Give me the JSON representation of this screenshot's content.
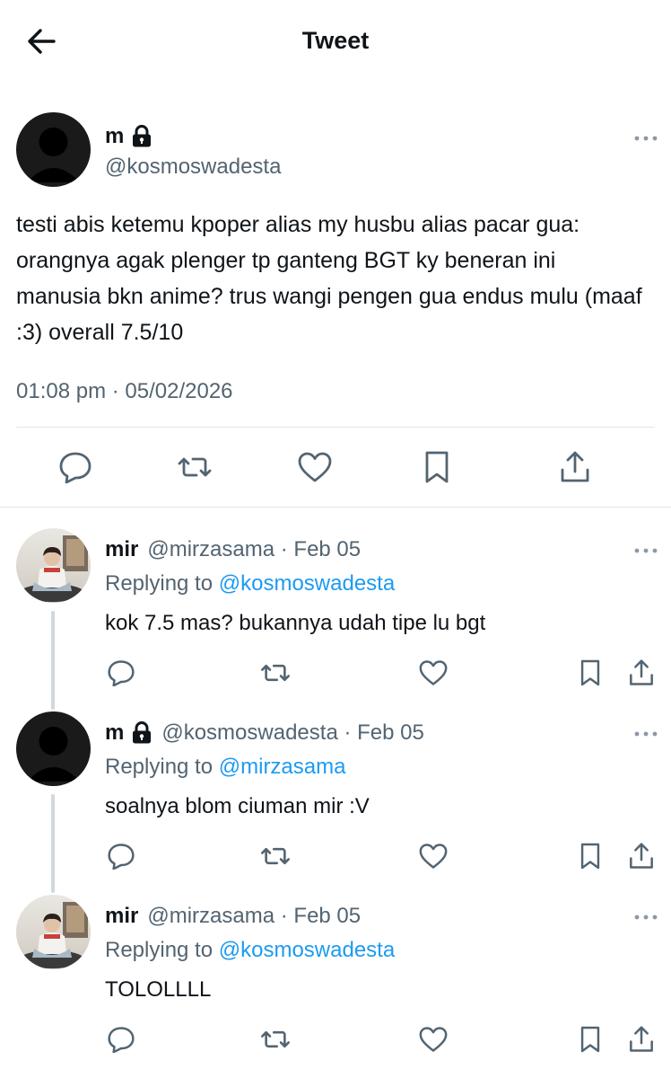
{
  "header": {
    "title": "Tweet",
    "back_icon": "arrow-left-icon"
  },
  "main_tweet": {
    "display_name": "m",
    "handle": "@kosmoswadesta",
    "text": "testi abis ketemu kpoper alias my husbu alias pacar gua: orangnya agak plenger tp ganteng BGT ky beneran ini manusia bkn anime? trus wangi pengen gua endus mulu (maaf :3) overall 7.5/10",
    "timestamp": "01:08 pm · 05/02/2026",
    "actions": [
      "reply-icon",
      "retweet-icon",
      "like-icon",
      "bookmark-icon",
      "share-icon"
    ]
  },
  "replies": [
    {
      "display_name": "mir",
      "handle": "@mirzasama · Feb 05",
      "replying_label": "Replying to",
      "replying_to": "@kosmoswadesta",
      "text": "kok 7.5 mas? bukannya udah tipe lu bgt",
      "locked": false
    },
    {
      "display_name": "m",
      "handle": "@kosmoswadesta · Feb 05",
      "replying_label": "Replying to",
      "replying_to": "@mirzasama",
      "text": "soalnya blom ciuman mir :V",
      "locked": true
    },
    {
      "display_name": "mir",
      "handle": "@mirzasama · Feb 05",
      "replying_label": "Replying to",
      "replying_to": "@kosmoswadesta",
      "text": "TOLOLLLL",
      "locked": false
    }
  ],
  "colors": {
    "text": "#0f1419",
    "secondary": "#536471",
    "link": "#1d9bf0",
    "divider": "#e3e7ea",
    "thread_line": "#cfd9de"
  }
}
